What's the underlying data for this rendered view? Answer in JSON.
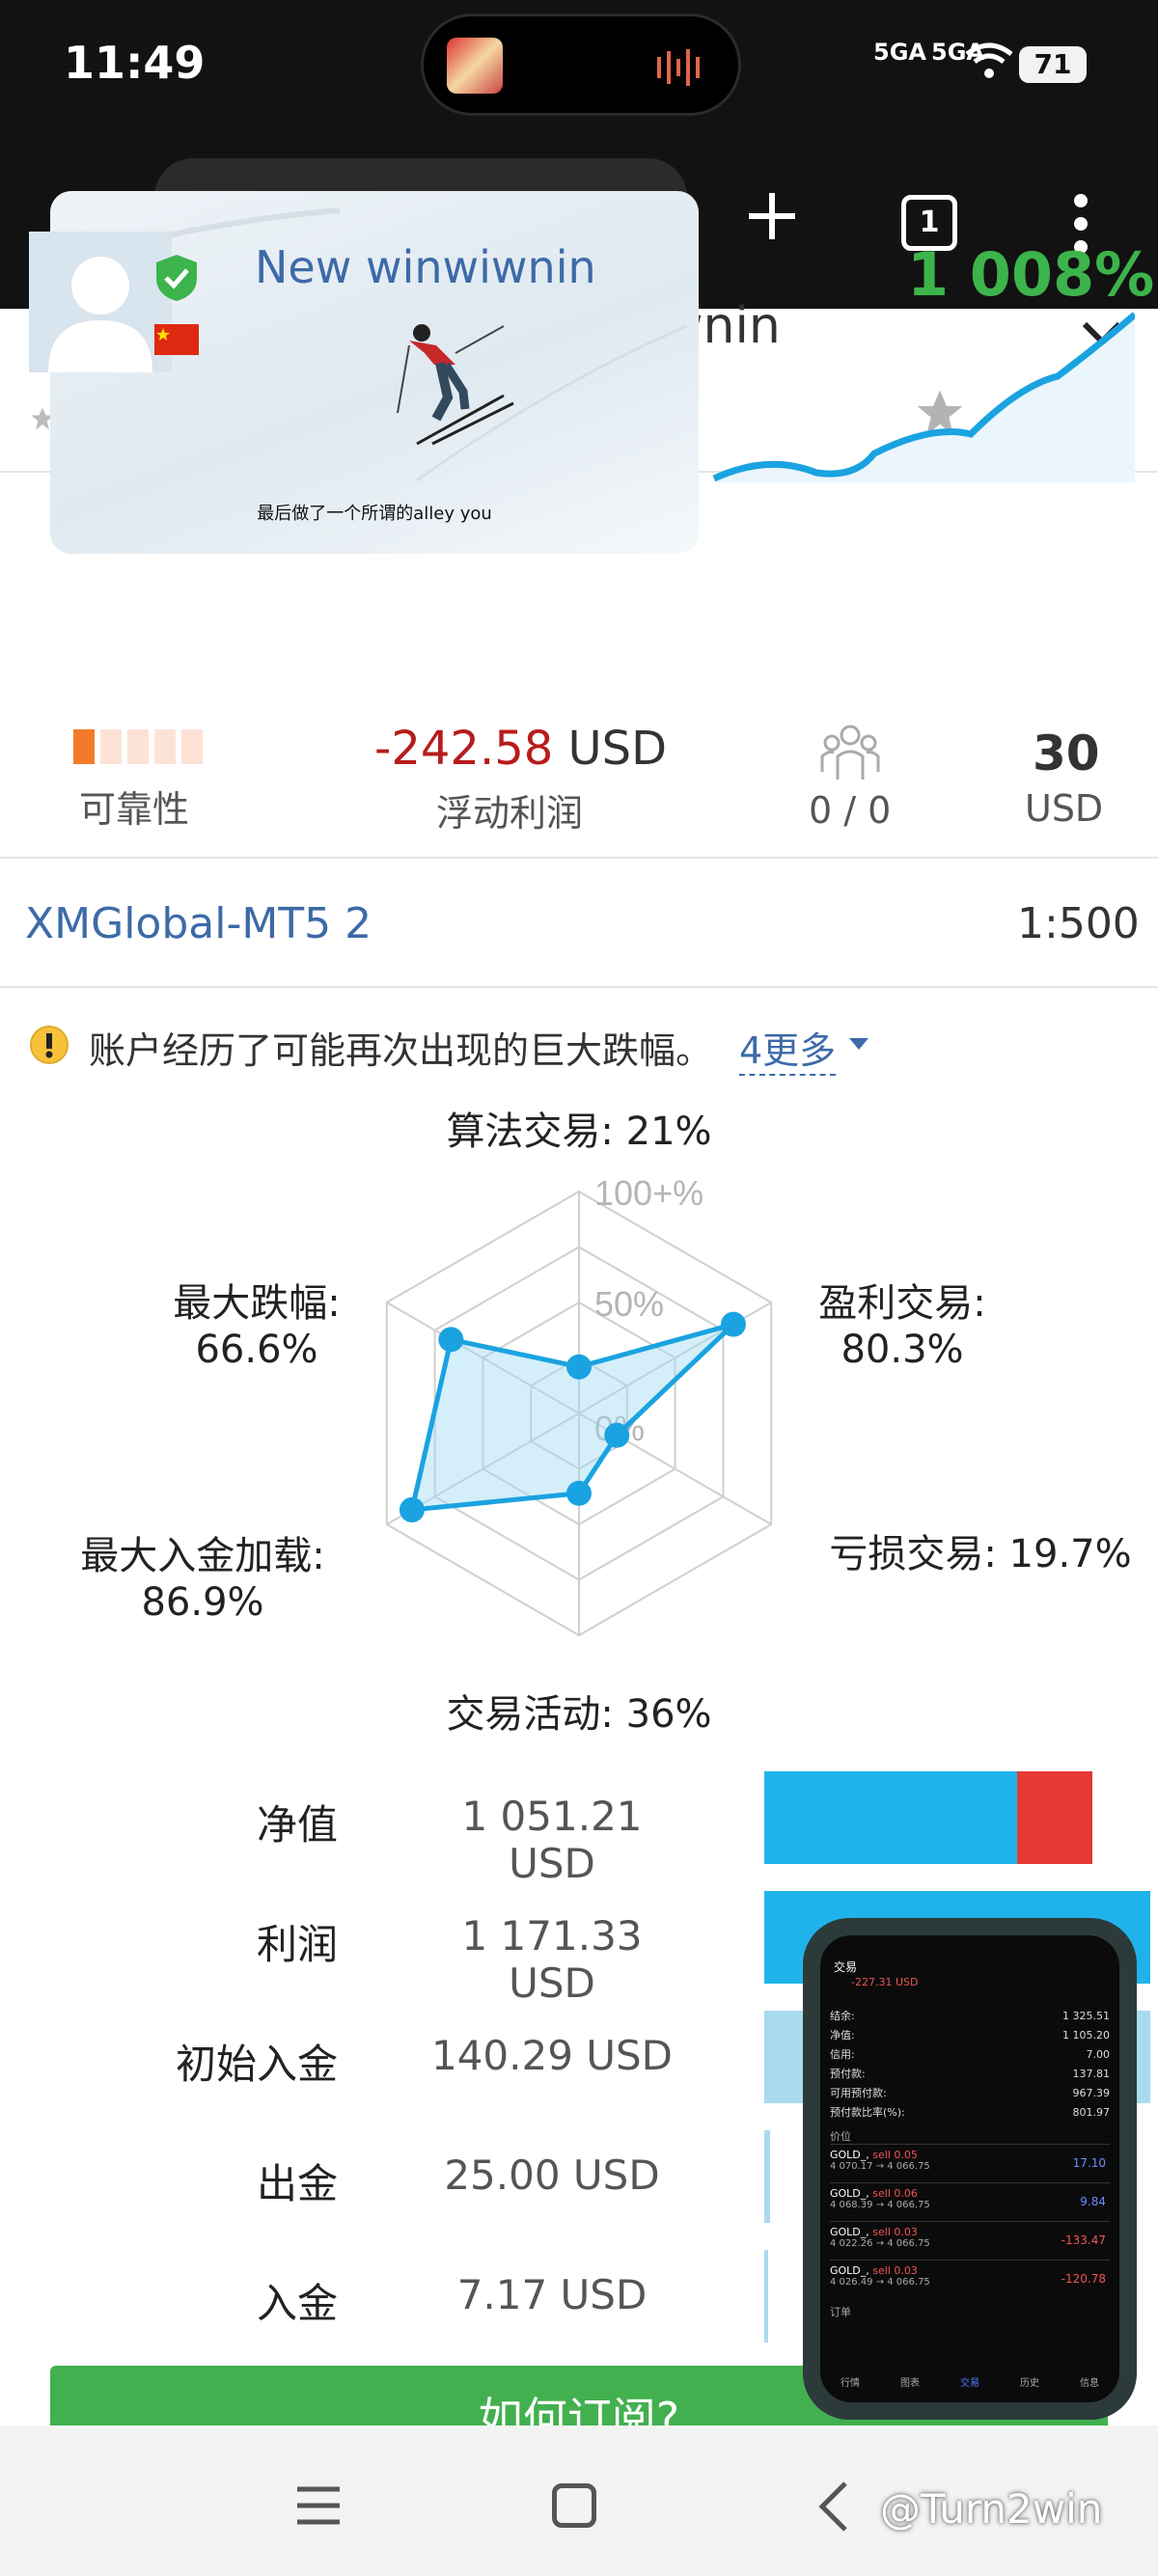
{
  "status_bar": {
    "time": "11:49",
    "signal_1": "5GA",
    "signal_2": "5GA",
    "battery": "71"
  },
  "browser": {
    "tab_count": "1"
  },
  "video_pip": {
    "subtitle": "最后做了一个所谓的alley you"
  },
  "signal": {
    "name_partial": "N",
    "name_partial_tail": "wnin",
    "title": "New winwiwnin",
    "growth": "1 008%",
    "floating_profit_value": "-242.58",
    "floating_profit_currency": "USD",
    "floating_profit_label": "浮动利润",
    "reliability_label": "可靠性",
    "reliability_level": 1,
    "reliability_max": 5,
    "subscribers": "0 / 0",
    "min_deposit": "30",
    "min_deposit_currency": "USD",
    "server": "XMGlobal-MT5 2",
    "leverage": "1:500"
  },
  "warning": {
    "text": "账户经历了可能再次出现的巨大跌幅。",
    "more": "4更多"
  },
  "chart_data": {
    "type": "radar",
    "axes": [
      "算法交易",
      "盈利交易",
      "亏损交易",
      "交易活动",
      "最大入金加载",
      "最大跌幅"
    ],
    "labels": [
      "算法交易: 21%",
      "盈利交易: 80.3%",
      "亏损交易: 19.7%",
      "交易活动: 36%",
      "最大入金加载: 86.9%",
      "最大跌幅: 66.6%"
    ],
    "values": [
      21,
      80.3,
      19.7,
      36,
      86.9,
      66.6
    ],
    "ticks": [
      "0%",
      "50%",
      "100+%"
    ],
    "range": [
      0,
      100
    ]
  },
  "metrics": [
    {
      "label": "净值",
      "value": "1 051.21 USD"
    },
    {
      "label": "利润",
      "value": "1 171.33 USD"
    },
    {
      "label": "初始入金",
      "value": "140.29 USD"
    },
    {
      "label": "出金",
      "value": "25.00 USD"
    },
    {
      "label": "入金",
      "value": "7.17 USD"
    }
  ],
  "subscribe_button": "如何订阅?",
  "phone_thumb": {
    "title": "交易",
    "pl": "-227.31 USD",
    "rows": [
      {
        "k": "结余:",
        "v": "1 325.51"
      },
      {
        "k": "净值:",
        "v": "1 105.20"
      },
      {
        "k": "信用:",
        "v": "7.00"
      },
      {
        "k": "预付款:",
        "v": "137.81"
      },
      {
        "k": "可用预付款:",
        "v": "967.39"
      },
      {
        "k": "预付款比率(%):",
        "v": "801.97"
      }
    ],
    "section": "价位",
    "orders": [
      {
        "sym": "GOLD_,",
        "side": "sell 0.05",
        "px": "4 070.17 → 4 066.75",
        "pl": "17.10",
        "pl_color": "#6a8cff"
      },
      {
        "sym": "GOLD_,",
        "side": "sell 0.06",
        "px": "4 068.39 → 4 066.75",
        "pl": "9.84",
        "pl_color": "#6a8cff"
      },
      {
        "sym": "GOLD_,",
        "side": "sell 0.03",
        "px": "4 022.26 → 4 066.75",
        "pl": "-133.47",
        "pl_color": "#e55"
      },
      {
        "sym": "GOLD_,",
        "side": "sell 0.03",
        "px": "4 026.49 → 4 066.75",
        "pl": "-120.78",
        "pl_color": "#e55"
      }
    ],
    "section2": "订单",
    "nav": [
      "行情",
      "图表",
      "交易",
      "历史",
      "信息"
    ]
  },
  "watermark": "@Turn2win",
  "colors": {
    "accent": "#1aa3e0",
    "profit_green": "#3cb44b",
    "loss_red": "#b71c1c",
    "link_blue": "#3d6aa8"
  }
}
